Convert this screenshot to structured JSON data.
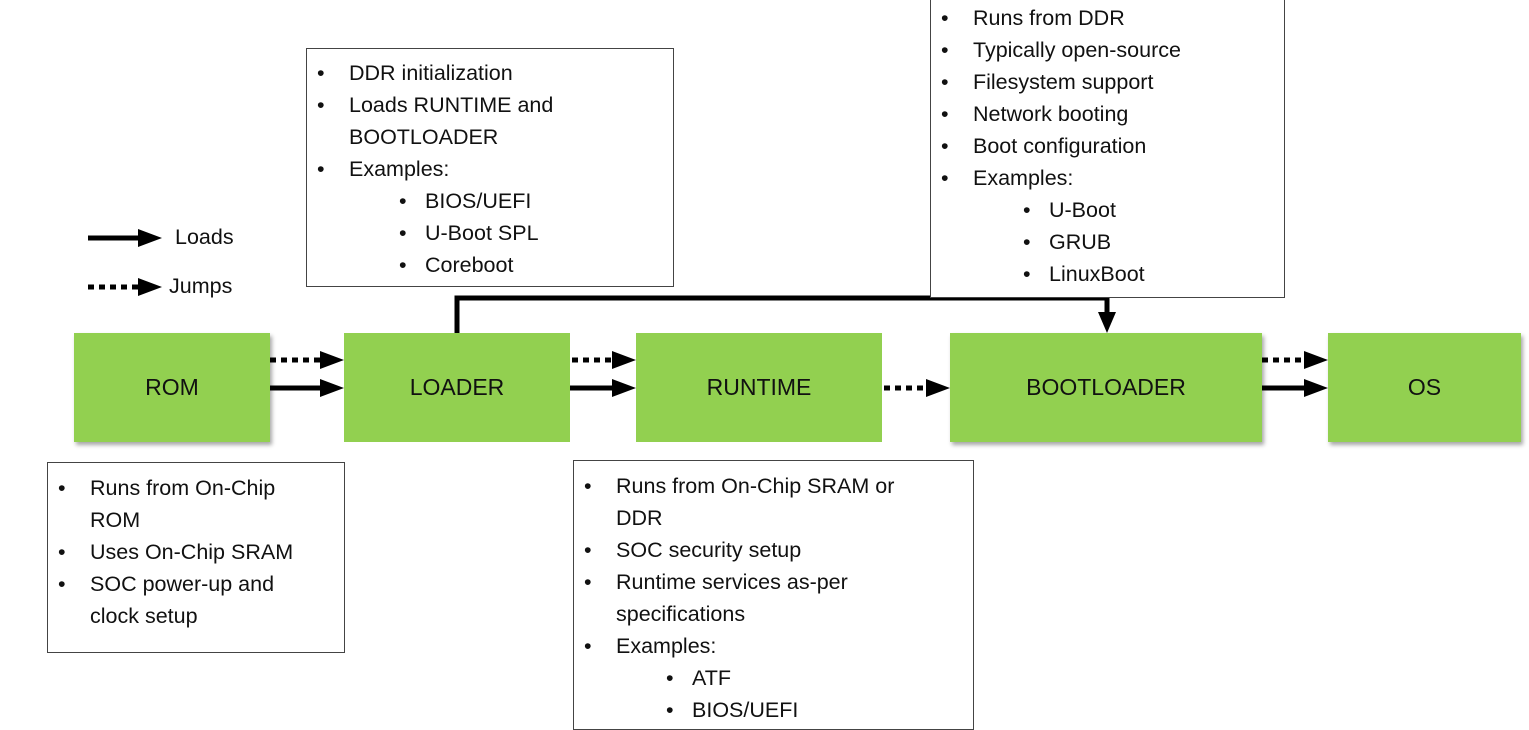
{
  "legend": {
    "loads_label": "Loads",
    "jumps_label": "Jumps"
  },
  "stages": [
    {
      "id": "rom",
      "label": "ROM"
    },
    {
      "id": "loader",
      "label": "LOADER"
    },
    {
      "id": "runtime",
      "label": "RUNTIME"
    },
    {
      "id": "bootloader",
      "label": "BOOTLOADER"
    },
    {
      "id": "os",
      "label": "OS"
    }
  ],
  "notes": {
    "rom": {
      "items": [
        "Runs from On-Chip ROM",
        "Uses On-Chip SRAM",
        "SOC power-up and clock setup"
      ]
    },
    "loader": {
      "items": [
        "DDR initialization",
        "Loads RUNTIME and BOOTLOADER",
        "Examples:"
      ],
      "examples": [
        "BIOS/UEFI",
        "U-Boot SPL",
        "Coreboot"
      ]
    },
    "runtime": {
      "items": [
        "Runs from On-Chip SRAM or DDR",
        "SOC security setup",
        "Runtime services as-per specifications",
        "Examples:"
      ],
      "examples": [
        "ATF",
        "BIOS/UEFI"
      ]
    },
    "bootloader": {
      "items": [
        "Runs from DDR",
        "Typically open-source",
        "Filesystem support",
        "Network booting",
        "Boot configuration",
        "Examples:"
      ],
      "examples": [
        "U-Boot",
        "GRUB",
        "LinuxBoot"
      ]
    }
  },
  "connections": [
    {
      "from": "rom",
      "to": "loader",
      "types": [
        "jumps",
        "loads"
      ]
    },
    {
      "from": "loader",
      "to": "runtime",
      "types": [
        "jumps",
        "loads"
      ]
    },
    {
      "from": "loader",
      "to": "bootloader",
      "types": [
        "loads"
      ]
    },
    {
      "from": "runtime",
      "to": "bootloader",
      "types": [
        "jumps"
      ]
    },
    {
      "from": "bootloader",
      "to": "os",
      "types": [
        "jumps",
        "loads"
      ]
    }
  ],
  "colors": {
    "stage_fill": "#92D050",
    "arrow": "#000000"
  }
}
